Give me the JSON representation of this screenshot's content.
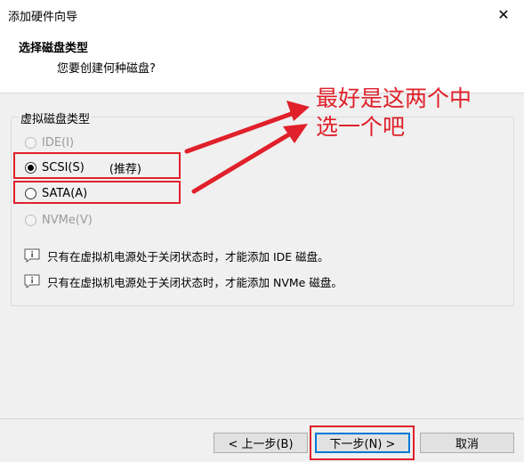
{
  "window": {
    "title": "添加硬件向导",
    "close_glyph": "✕"
  },
  "header": {
    "title": "选择磁盘类型",
    "subtitle": "您要创建何种磁盘?"
  },
  "group": {
    "legend": "虚拟磁盘类型",
    "options": [
      {
        "label": "IDE(I)",
        "checked": false,
        "disabled": true
      },
      {
        "label": "SCSI(S)",
        "note": "(推荐)",
        "checked": true,
        "disabled": false
      },
      {
        "label": "SATA(A)",
        "checked": false,
        "disabled": false
      },
      {
        "label": "NVMe(V)",
        "checked": false,
        "disabled": true
      }
    ],
    "info": [
      "只有在虚拟机电源处于关闭状态时，才能添加 IDE 磁盘。",
      "只有在虚拟机电源处于关闭状态时，才能添加 NVMe 磁盘。"
    ]
  },
  "annotation": {
    "line1": "最好是这两个中",
    "line2": "选一个吧",
    "color": "#e0202a"
  },
  "buttons": {
    "back": "< 上一步(B)",
    "next": "下一步(N) >",
    "cancel": "取消"
  }
}
